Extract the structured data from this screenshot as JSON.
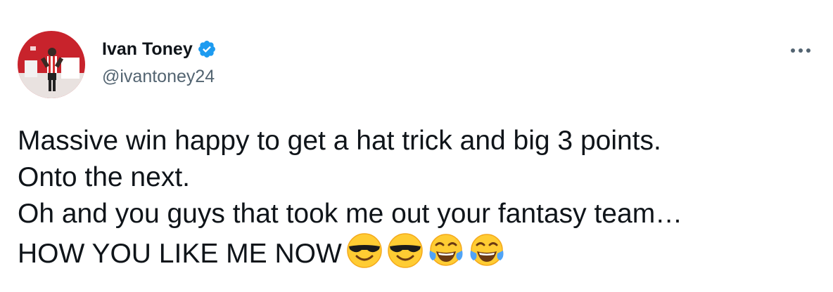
{
  "author": {
    "display_name": "Ivan Toney",
    "handle": "@ivantoney24",
    "verified_icon": "verified-badge-icon",
    "avatar_icon": "avatar"
  },
  "colors": {
    "text_primary": "#0f1419",
    "text_secondary": "#536471",
    "verified_blue": "#1d9bf0"
  },
  "more_icon": "more-options-icon",
  "tweet": {
    "lines": [
      "Massive win happy to get a hat trick and big 3 points.",
      "Onto the next.",
      "Oh and you guys that took me out your fantasy team…",
      "HOW YOU LIKE ME NOW"
    ],
    "emojis": [
      "smiling-face-with-sunglasses-icon",
      "smiling-face-with-sunglasses-icon",
      "face-with-tears-of-joy-icon",
      "face-with-tears-of-joy-icon"
    ]
  }
}
